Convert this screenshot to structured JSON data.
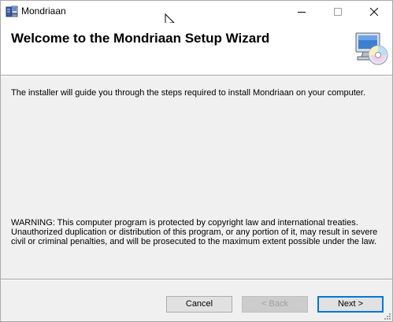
{
  "window": {
    "title": "Mondriaan",
    "icons": [
      "installer-app-icon",
      "minimize-icon",
      "maximize-icon",
      "close-icon",
      "computer-cd-icon",
      "mouse-cursor-icon",
      "resize-grip-icon"
    ]
  },
  "banner": {
    "title": "Welcome to the Mondriaan Setup Wizard"
  },
  "body": {
    "intro": "The installer will guide you through the steps required to install Mondriaan on your computer.",
    "warning": "WARNING: This computer program is protected by copyright law and international treaties. Unauthorized duplication or distribution of this program, or any portion of it, may result in severe civil or criminal penalties, and will be prosecuted to the maximum extent possible under the law."
  },
  "buttons": {
    "cancel": {
      "label": "Cancel",
      "enabled": true
    },
    "back": {
      "label": "< Back",
      "enabled": false
    },
    "next": {
      "label": "Next >",
      "enabled": true,
      "default": true
    }
  },
  "colors": {
    "window_bg": "#f0f0f0",
    "banner_bg": "#ffffff",
    "accent": "#0078d7",
    "disabled_text": "#a0a0a0"
  }
}
